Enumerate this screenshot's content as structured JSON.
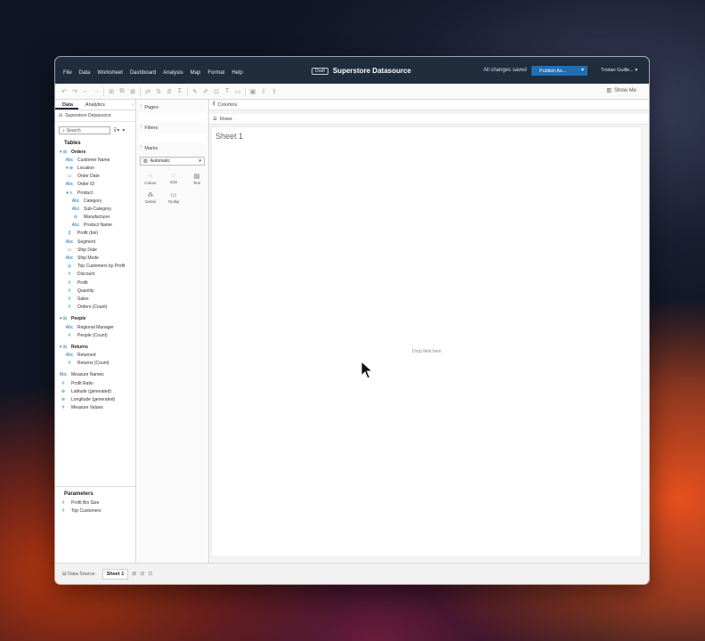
{
  "menubar": {
    "menus": [
      "File",
      "Data",
      "Worksheet",
      "Dashboard",
      "Analysis",
      "Map",
      "Format",
      "Help"
    ],
    "draft_badge": "Draft",
    "title": "Superstore Datasource",
    "saved_status": "All changes saved",
    "publish_label": "Publish As...",
    "user": "Tristan Guille..."
  },
  "toolbar": {
    "show_me": "Show Me"
  },
  "left_pane": {
    "tab_data": "Data",
    "tab_analytics": "Analytics",
    "datasource": "Superstore Datasource",
    "search_placeholder": "Search",
    "tables_title": "Tables",
    "fields": [
      {
        "icon": "▾ ⊞",
        "label": "Orders",
        "type": "table",
        "indent": 0
      },
      {
        "icon": "Abc",
        "label": "Customer Name",
        "type": "dim",
        "indent": 1
      },
      {
        "icon": "▾ ⊕",
        "label": "Location",
        "type": "dim",
        "indent": 1
      },
      {
        "icon": "▭",
        "label": "Order Date",
        "type": "dim",
        "indent": 1
      },
      {
        "icon": "Abc",
        "label": "Order ID",
        "type": "dim",
        "indent": 1
      },
      {
        "icon": "▾ ⅄",
        "label": "Product",
        "type": "dim",
        "indent": 1
      },
      {
        "icon": "Abc",
        "label": "Category",
        "type": "dim",
        "indent": 2
      },
      {
        "icon": "Abc",
        "label": "Sub-Category",
        "type": "dim",
        "indent": 2
      },
      {
        "icon": "⊘",
        "label": "Manufacturer",
        "type": "dim",
        "indent": 2
      },
      {
        "icon": "Abc",
        "label": "Product Name",
        "type": "dim",
        "indent": 2
      },
      {
        "icon": "⫼",
        "label": "Profit (bin)",
        "type": "dim",
        "indent": 1
      },
      {
        "icon": "Abc",
        "label": "Segment",
        "type": "dim",
        "indent": 1
      },
      {
        "icon": "▭",
        "label": "Ship Date",
        "type": "dim",
        "indent": 1
      },
      {
        "icon": "Abc",
        "label": "Ship Mode",
        "type": "dim",
        "indent": 1
      },
      {
        "icon": "◎",
        "label": "Top Customers by Profit",
        "type": "dim",
        "indent": 1
      },
      {
        "icon": "#",
        "label": "Discount",
        "type": "mea",
        "indent": 1
      },
      {
        "icon": "#",
        "label": "Profit",
        "type": "mea",
        "indent": 1
      },
      {
        "icon": "#",
        "label": "Quantity",
        "type": "mea",
        "indent": 1
      },
      {
        "icon": "#",
        "label": "Sales",
        "type": "mea",
        "indent": 1
      },
      {
        "icon": "#",
        "label": "Orders (Count)",
        "type": "mea",
        "indent": 1
      },
      {
        "icon": "",
        "label": "",
        "type": "gap",
        "indent": 0
      },
      {
        "icon": "▾ ⊞",
        "label": "People",
        "type": "table",
        "indent": 0
      },
      {
        "icon": "Abc",
        "label": "Regional Manager",
        "type": "dim",
        "indent": 1
      },
      {
        "icon": "#",
        "label": "People (Count)",
        "type": "mea",
        "indent": 1
      },
      {
        "icon": "",
        "label": "",
        "type": "gap",
        "indent": 0
      },
      {
        "icon": "▾ ⊞",
        "label": "Returns",
        "type": "table",
        "indent": 0
      },
      {
        "icon": "Abc",
        "label": "Returned",
        "type": "dim",
        "indent": 1
      },
      {
        "icon": "#",
        "label": "Returns (Count)",
        "type": "mea",
        "indent": 1
      },
      {
        "icon": "",
        "label": "",
        "type": "gap",
        "indent": 0
      },
      {
        "icon": "Abc",
        "label": "Measure Names",
        "type": "dim",
        "indent": 0
      },
      {
        "icon": "#",
        "label": "Profit Ratio",
        "type": "mea",
        "indent": 0
      },
      {
        "icon": "⊕",
        "label": "Latitude (generated)",
        "type": "mea",
        "indent": 0
      },
      {
        "icon": "⊕",
        "label": "Longitude (generated)",
        "type": "mea",
        "indent": 0
      },
      {
        "icon": "#",
        "label": "Measure Values",
        "type": "mea",
        "indent": 0
      }
    ],
    "parameters_title": "Parameters",
    "parameters": [
      "Profit Bin Size",
      "Top Customers"
    ]
  },
  "mid_pane": {
    "pages": "Pages",
    "filters": "Filters",
    "marks": "Marks",
    "marks_type": "Automatic",
    "mark_buttons": [
      {
        "glyph": "⁘",
        "label": "Colour",
        "icon": "colour-icon"
      },
      {
        "glyph": "◌",
        "label": "Size",
        "icon": "size-icon"
      },
      {
        "glyph": "▤",
        "label": "Text",
        "icon": "text-icon"
      },
      {
        "glyph": "⁂",
        "label": "Detail",
        "icon": "detail-icon"
      },
      {
        "glyph": "▭",
        "label": "Tooltip",
        "icon": "tooltip-icon"
      }
    ]
  },
  "main": {
    "columns": "Columns",
    "rows": "Rows",
    "sheet_title": "Sheet 1",
    "drop_hint": "Drop field here"
  },
  "bottom": {
    "data_source_tab": "Data Source",
    "sheet_tab": "Sheet 1"
  },
  "colors": {
    "menubar_bg": "#1f2d3d",
    "publish_bg": "#1f6fb5",
    "dimension_icon": "#1f77b4",
    "measure_icon": "#1ea17c"
  }
}
